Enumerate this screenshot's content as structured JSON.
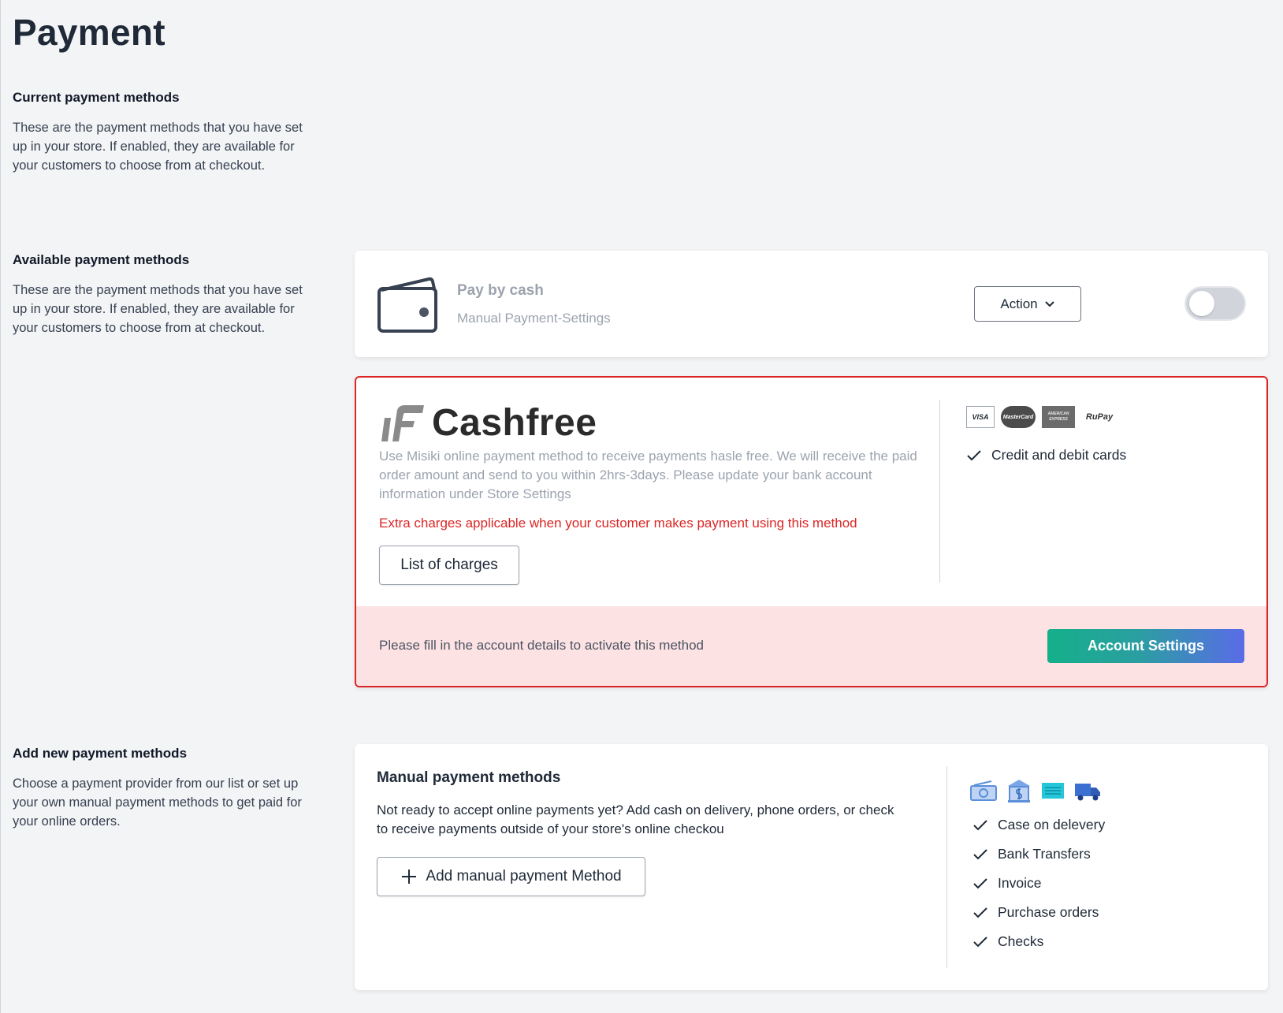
{
  "page": {
    "title": "Payment"
  },
  "sections": {
    "current": {
      "heading": "Current payment methods",
      "description": "These are the payment methods that you have set up in your store. If enabled, they are available for your customers to choose from at checkout."
    },
    "available": {
      "heading": "Available payment methods",
      "description": "These are the payment methods that you have set up in your store. If enabled, they are available for your customers to choose from at checkout."
    },
    "add_new": {
      "heading": "Add new payment methods",
      "description": "Choose a payment provider from our list or set up your own manual payment methods to get paid for your online orders."
    }
  },
  "cash": {
    "title": "Pay by cash",
    "subtitle": "Manual Payment-Settings",
    "action_label": "Action",
    "enabled": false
  },
  "cashfree": {
    "brand": "Cashfree",
    "description": "Use Misiki online payment method to receive payments hasle free. We will receive the paid order amount and send to you within 2hrs-3days. Please update your bank account information under Store Settings",
    "extra_charges": "Extra charges applicable when your customer makes payment using this method",
    "charges_button": "List of charges",
    "card_logos": [
      "VISA",
      "MasterCard",
      "AMERICAN EXPRESS",
      "RuPay"
    ],
    "feature": "Credit and debit cards",
    "footer_message": "Please fill in the account details to activate this method",
    "account_button": "Account Settings",
    "colors": {
      "border": "#dc2626",
      "footer_bg": "#fde2e4"
    }
  },
  "manual": {
    "title": "Manual payment methods",
    "description": "Not ready to accept online payments yet? Add cash on delivery, phone orders, or check to receive payments outside of your store's online checkou",
    "add_button": "Add manual payment Method",
    "icons": [
      "cash-icon",
      "bank-icon",
      "invoice-icon",
      "truck-icon"
    ],
    "features": [
      "Case on delevery",
      "Bank Transfers",
      "Invoice",
      "Purchase orders",
      "Checks"
    ]
  }
}
